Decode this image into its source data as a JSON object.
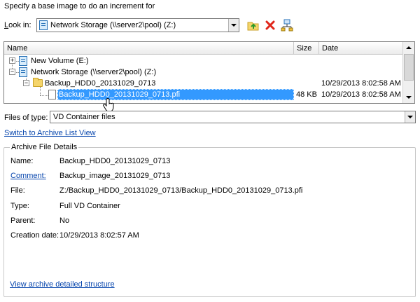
{
  "heading": "Specify a base image to do an increment for",
  "look_in": {
    "label_accel": "L",
    "label_rest": "ook in:",
    "value": "Network Storage (\\\\server2\\pool) (Z:)"
  },
  "toolbar": [
    {
      "name": "up-folder-icon"
    },
    {
      "name": "delete-icon"
    },
    {
      "name": "network-icon"
    }
  ],
  "list": {
    "columns": {
      "name": "Name",
      "size": "Size",
      "date": "Date"
    },
    "rows": [
      {
        "name": "New Volume (E:)",
        "size": "",
        "date": ""
      },
      {
        "name": "Network Storage (\\\\server2\\pool) (Z:)",
        "size": "",
        "date": ""
      },
      {
        "name": "Backup_HDD0_20131029_0713",
        "size": "",
        "date": "10/29/2013 8:02:58 AM"
      },
      {
        "name": "Backup_HDD0_20131029_0713.pfi",
        "size": "48 KB",
        "date": "10/29/2013 8:02:58 AM"
      }
    ]
  },
  "files_of_type": {
    "label_pre": "Files of ",
    "label_accel": "t",
    "label_post": "ype:",
    "value": "VD Container files"
  },
  "switch_link": "Switch to Archive List View",
  "details": {
    "title": "Archive File Details",
    "name_label": "Name:",
    "name_value": "Backup_HDD0_20131029_0713",
    "comment_label": "Comment:",
    "comment_value": "Backup_image_20131029_0713",
    "file_label": "File:",
    "file_value": "Z:/Backup_HDD0_20131029_0713/Backup_HDD0_20131029_0713.pfi",
    "type_label": "Type:",
    "type_value": "Full VD Container",
    "parent_label": "Parent:",
    "parent_value": "No",
    "created_label": "Creation date:",
    "created_value": "10/29/2013 8:02:57 AM",
    "structure_link": "View archive detailed structure"
  },
  "colors": {
    "selection": "#3399ff",
    "link": "#0645ad"
  }
}
